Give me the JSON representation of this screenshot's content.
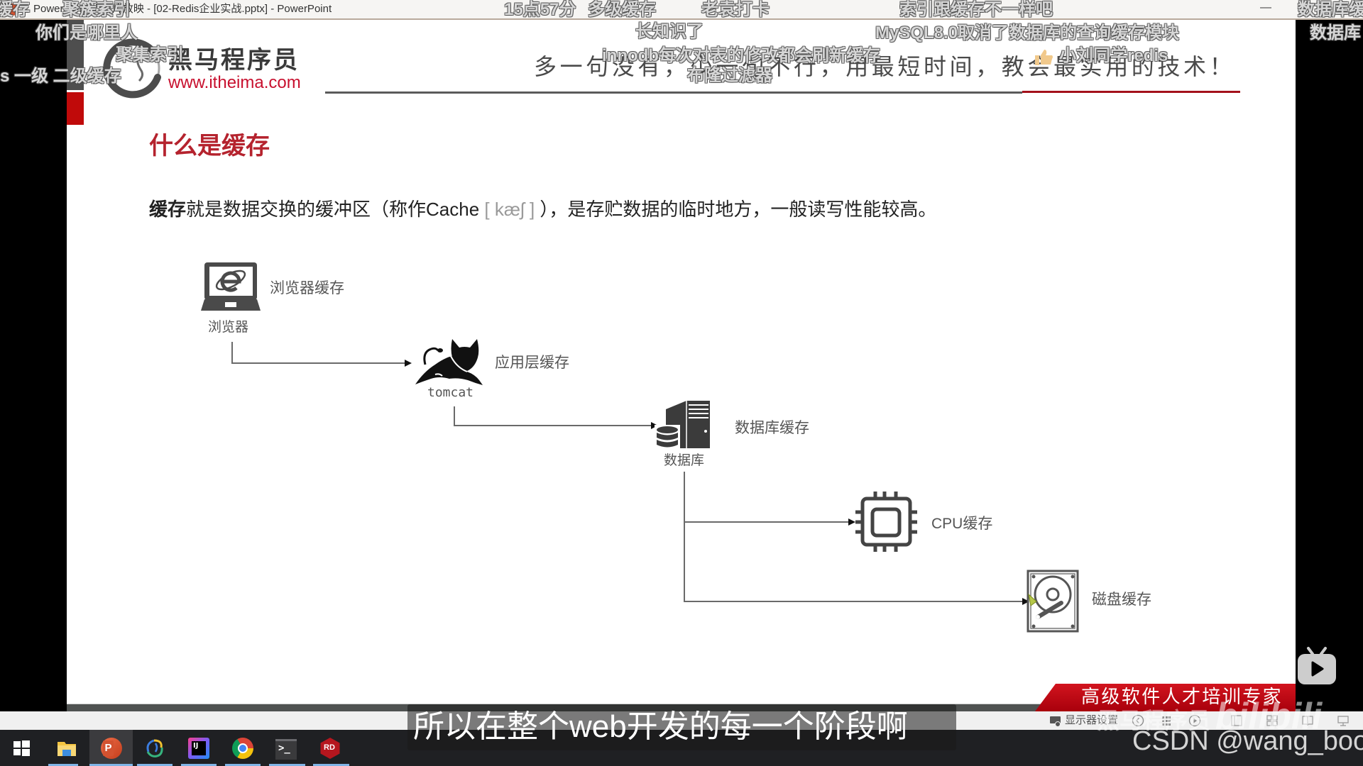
{
  "window": {
    "title": "PowerPoint 幻灯片放映 - [02-Redis企业实战.pptx] - PowerPoint",
    "minimize_glyph": "—"
  },
  "slide": {
    "brand_name": "黑马程序员",
    "brand_url": "www.itheima.com",
    "slogan": "多一句没有，少一句不行，用最短时间，教会最实用的技术！",
    "heading": "什么是缓存",
    "definition": {
      "term": "缓存",
      "text_before": "就是数据交换的缓冲区（称作Cache ",
      "phonetic": "[ kæʃ ]",
      "text_after": " ），是存贮数据的临时地方，一般读写性能较高。"
    },
    "diagram": {
      "nodes": [
        {
          "id": "browser",
          "label": "浏览器",
          "cache_label": "浏览器缓存",
          "icon": "laptop-ie-icon"
        },
        {
          "id": "tomcat",
          "label": "tomcat",
          "cache_label": "应用层缓存",
          "icon": "tomcat-icon"
        },
        {
          "id": "database",
          "label": "数据库",
          "cache_label": "数据库缓存",
          "icon": "database-server-icon"
        },
        {
          "id": "cpu",
          "label": "",
          "cache_label": "CPU缓存",
          "icon": "cpu-chip-icon"
        },
        {
          "id": "disk",
          "label": "",
          "cache_label": "磁盘缓存",
          "icon": "hard-disk-icon"
        }
      ],
      "edges": [
        [
          "browser",
          "tomcat"
        ],
        [
          "tomcat",
          "database"
        ],
        [
          "database",
          "cpu"
        ],
        [
          "database",
          "disk"
        ]
      ]
    },
    "footer_banner": "高级软件人才培训专家"
  },
  "status_bar": {
    "display_settings": "显示器设置",
    "icons": [
      "monitor-settings-icon",
      "previous-slide-icon",
      "slide-menu-icon",
      "next-slide-icon",
      "normal-view-icon",
      "slide-sorter-icon",
      "reading-view-icon",
      "slideshow-icon"
    ]
  },
  "taskbar": {
    "apps": [
      {
        "icon": "windows-start-icon",
        "glyph": ""
      },
      {
        "icon": "file-explorer-icon",
        "glyph": ""
      },
      {
        "icon": "powerpoint-icon",
        "glyph": "P",
        "active": true
      },
      {
        "icon": "navicat-icon",
        "glyph": ""
      },
      {
        "icon": "intellij-idea-icon",
        "glyph": "IJ"
      },
      {
        "icon": "chrome-icon",
        "glyph": ""
      },
      {
        "icon": "terminal-icon",
        "glyph": ">_"
      },
      {
        "icon": "redis-desktop-manager-icon",
        "glyph": "RD"
      }
    ]
  },
  "overlay": {
    "danmaku": [
      "缓存",
      "聚簇索引",
      "15点57分",
      "多级缓存",
      "老袁打卡",
      "索引跟缓存不一样吧",
      "数据库缓",
      "你们是哪里人",
      "长知识了",
      "MySQL8.0取消了数据库的查询缓存模块",
      "数据库",
      "聚集索引",
      "innodb每次对表的修改都会刷新缓存",
      "小刘同学redis",
      "s 一级 二级缓存",
      "布隆过滤器"
    ],
    "subtitle": "所以在整个web开发的每一个阶段啊",
    "bilibili_watermark": {
      "channel": "黑马程序员",
      "logo": "bilibili"
    },
    "csdn_watermark": "CSDN @wang_book"
  },
  "colors": {
    "heading_red": "#b5232e",
    "brand_red": "#c8102e",
    "banner_red": "#c4111b",
    "taskbar_indicator": "#7fb4e6",
    "taskbar_bg": "#1f2023"
  }
}
